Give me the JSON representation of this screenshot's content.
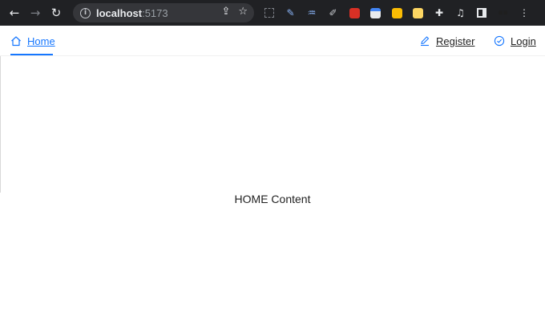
{
  "browser": {
    "url_host": "localhost",
    "url_port": ":5173",
    "icons": {
      "back": "arrow-left-icon",
      "forward": "arrow-right-icon",
      "reload": "reload-icon",
      "info": "info-icon",
      "share": "share-icon",
      "bookmark": "star-icon",
      "extensions": "puzzle-icon",
      "media": "media-control-icon",
      "sidepanel": "side-panel-icon",
      "menu": "kebab-menu-icon"
    }
  },
  "nav": {
    "home_label": "Home",
    "register_label": "Register",
    "login_label": "Login",
    "active": "home",
    "accent_color": "#1677ff"
  },
  "main": {
    "content_text": "HOME Content"
  }
}
